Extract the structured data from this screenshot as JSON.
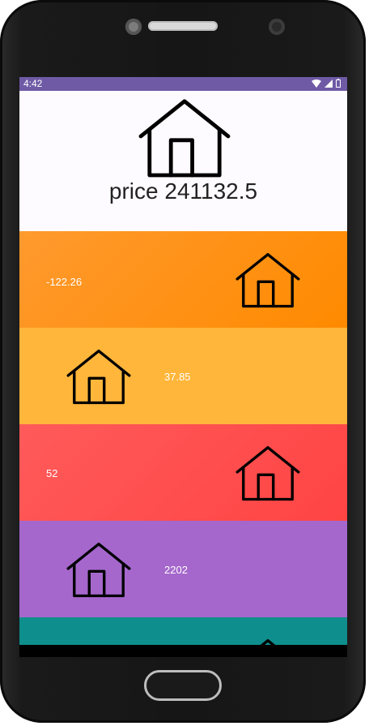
{
  "status_bar": {
    "time": "4:42"
  },
  "header": {
    "price_text": "price 241132.5"
  },
  "cards": [
    {
      "value": "-122.26",
      "color": "#ff8f1a"
    },
    {
      "value": "37.85",
      "color": "#ffb63a"
    },
    {
      "value": "52",
      "color": "#ff4a4a"
    },
    {
      "value": "2202",
      "color": "#a567cc"
    },
    {
      "value": "",
      "color": "#0e8e8c"
    }
  ],
  "icons": {
    "house": "house-icon"
  }
}
